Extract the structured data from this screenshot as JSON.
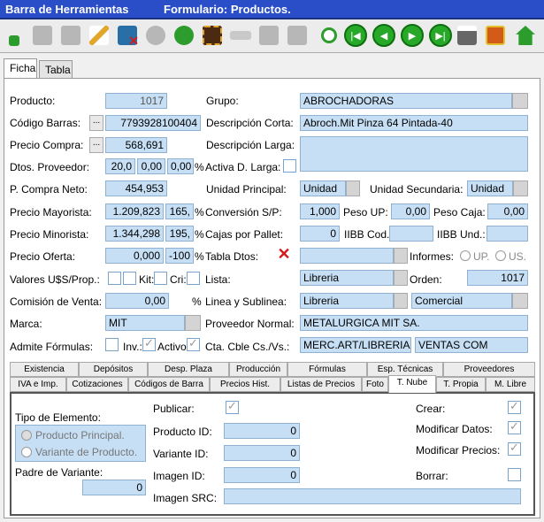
{
  "window": {
    "title_left": "Barra de Herramientas",
    "title_right": "Formulario: Productos."
  },
  "toolbar_icons": [
    "add-icon",
    "save-icon",
    "save-as-icon",
    "edit-icon",
    "delete-icon",
    "undo-icon",
    "refresh-icon",
    "film-icon",
    "back-arrow-icon",
    "grid-icon",
    "grid-alt-icon",
    "search-icon",
    "first-icon",
    "prev-icon",
    "next-icon",
    "last-icon",
    "print-icon",
    "gift-icon",
    "home-icon"
  ],
  "tabs": [
    "Ficha",
    "Tabla"
  ],
  "form": {
    "producto_label": "Producto:",
    "producto": "1017",
    "grupo_label": "Grupo:",
    "grupo": "ABROCHADORAS",
    "codbarras_label": "Código Barras:",
    "codbarras": "7793928100404",
    "desc_corta_label": "Descripción Corta:",
    "desc_corta": "Abroch.Mit Pinza 64 Pintada-40",
    "precio_compra_label": "Precio Compra:",
    "precio_compra": "568,691",
    "desc_larga_label": "Descripción Larga:",
    "dtos_prov_label": "Dtos. Proveedor:",
    "dto1": "20,0",
    "dto2": "0,00",
    "dto3": "0,00",
    "pct": "%",
    "activa_dlarga_label": "Activa D. Larga:",
    "pcompra_neto_label": "P. Compra Neto:",
    "pcompra_neto": "454,953",
    "unidad_principal_label": "Unidad Principal:",
    "unidad_principal": "Unidad",
    "unidad_secundaria_label": "Unidad Secundaria:",
    "unidad_secundaria": "Unidad",
    "precio_mayorista_label": "Precio Mayorista:",
    "precio_mayorista": "1.209,823",
    "margen_may": "165,",
    "conversion_label": "Conversión S/P:",
    "conversion": "1,000",
    "peso_up_label": "Peso UP:",
    "peso_up": "0,00",
    "peso_caja_label": "Peso Caja:",
    "peso_caja": "0,00",
    "precio_minorista_label": "Precio Minorista:",
    "precio_minorista": "1.344,298",
    "margen_min": "195,",
    "cajas_pallet_label": "Cajas por Pallet:",
    "cajas_pallet": "0",
    "iibb_cod_label": "IIBB Cod.",
    "iibb_und_label": "IIBB Und.:",
    "precio_oferta_label": "Precio Oferta:",
    "precio_oferta": "0,000",
    "oferta_pct": "-100",
    "tabla_dtos_label": "Tabla Dtos:",
    "informes_label": "Informes:",
    "informes_up": "UP.",
    "informes_us": "US.",
    "valores_label": "Valores U$S/Prop.:",
    "kit_label": "Kit:",
    "cri_label": "Cri:",
    "lista_label": "Lista:",
    "lista": "Libreria",
    "orden_label": "Orden:",
    "orden": "1017",
    "comision_label": "Comisión de Venta:",
    "comision": "0,00",
    "linea_label": "Linea y Sublinea:",
    "linea": "Libreria",
    "sublinea": "Comercial",
    "marca_label": "Marca:",
    "marca": "MIT",
    "proveedor_label": "Proveedor Normal:",
    "proveedor": "METALURGICA MIT SA.",
    "admite_label": "Admite Fórmulas:",
    "inv_label": "Inv.:",
    "activo_label": "Activo",
    "cta_label": "Cta. Cble Cs./Vs.:",
    "cta1": "MERC.ART/LIBRERIA",
    "cta2": "VENTAS COM"
  },
  "subtabs_row1": [
    "Existencia",
    "Depósitos",
    "Desp. Plaza",
    "Producción",
    "Fórmulas",
    "Esp. Técnicas",
    "Proveedores"
  ],
  "subtabs_row2": [
    "IVA e Imp.",
    "Cotizaciones",
    "Códigos de Barra",
    "Precios Hist.",
    "Listas de Precios",
    "Foto",
    "T. Nube",
    "T. Propia",
    "M. Libre"
  ],
  "nube": {
    "tipo_label": "Tipo de Elemento:",
    "opt1": "Producto Principal.",
    "opt2": "Variante de Producto.",
    "padre_label": "Padre de Variante:",
    "padre": "0",
    "publicar_label": "Publicar:",
    "producto_id_label": "Producto ID:",
    "producto_id": "0",
    "variante_id_label": "Variante ID:",
    "variante_id": "0",
    "imagen_id_label": "Imagen ID:",
    "imagen_id": "0",
    "imagen_src_label": "Imagen SRC:",
    "crear_label": "Crear:",
    "modificar_datos_label": "Modificar Datos:",
    "modificar_precios_label": "Modificar Precios:",
    "borrar_label": "Borrar:"
  }
}
